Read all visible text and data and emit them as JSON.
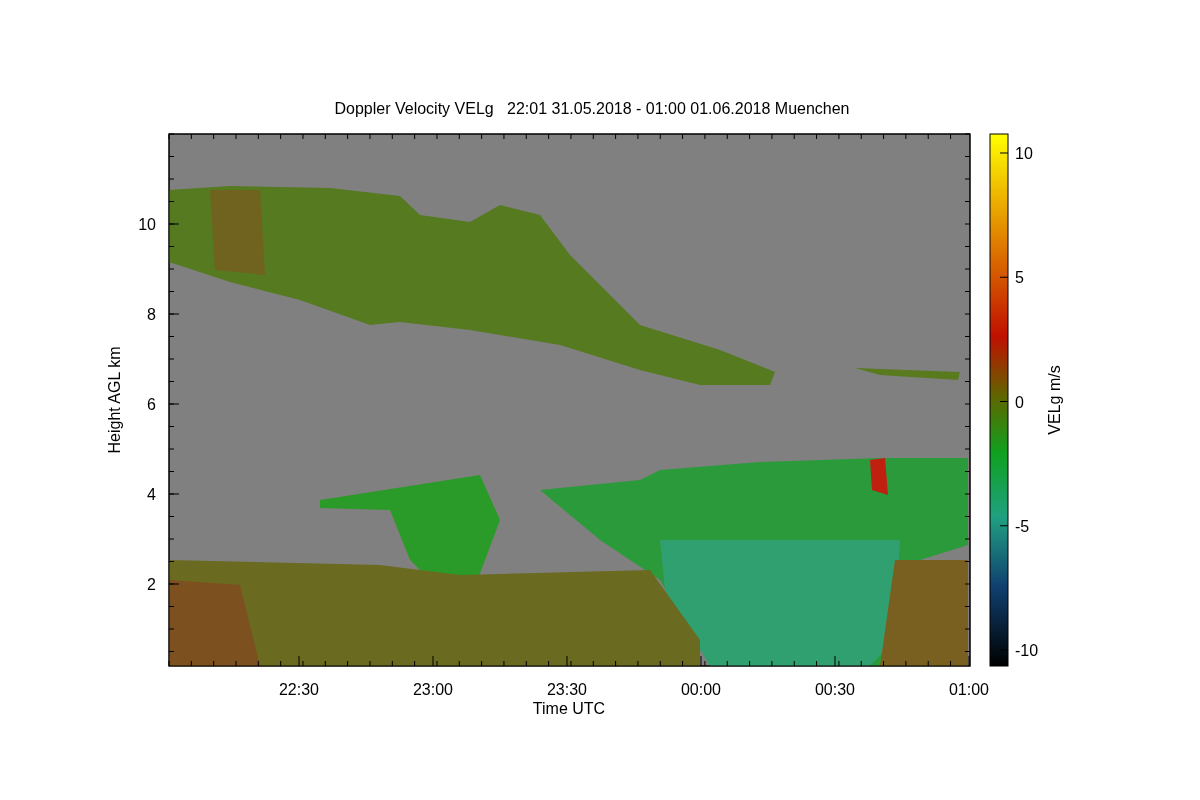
{
  "title": "Doppler Velocity VELg   22:01 31.05.2018 - 01:00 01.06.2018 Muenchen",
  "y_axis": {
    "label": "Height AGL km",
    "ticks": [
      "10",
      "8",
      "6",
      "4",
      "2"
    ]
  },
  "x_axis": {
    "label": "Time UTC",
    "ticks": [
      "22:30",
      "23:00",
      "23:30",
      "00:00",
      "00:30",
      "01:00"
    ]
  },
  "colorbar": {
    "label": "VELg m/s",
    "ticks": [
      "10",
      "5",
      "0",
      "-5",
      "-10"
    ]
  }
}
